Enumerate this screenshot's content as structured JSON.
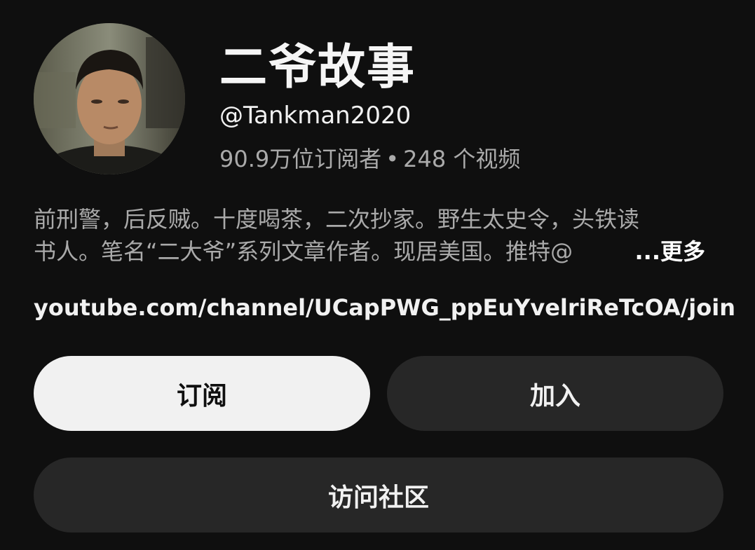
{
  "channel": {
    "name": "二爷故事",
    "handle": "@Tankman2020",
    "subscribers": "90.9万位订阅者",
    "separator": "•",
    "videos": "248 个视频",
    "description_line1": "前刑警，后反贼。十度喝茶，二次抄家。野生太史令，头铁读",
    "description_line2": "书人。笔名“二大爷”系列文章作者。现居美国。推特@",
    "more_label": "...更多",
    "link": "youtube.com/channel/UCapPWG_ppEuYvelriReTcOA/join"
  },
  "actions": {
    "subscribe_label": "订阅",
    "join_label": "加入",
    "community_label": "访问社区"
  },
  "colors": {
    "background": "#0f0f0f",
    "primary_button": "#f1f1f1",
    "secondary_button": "#272727",
    "secondary_text": "#aaaaaa"
  }
}
